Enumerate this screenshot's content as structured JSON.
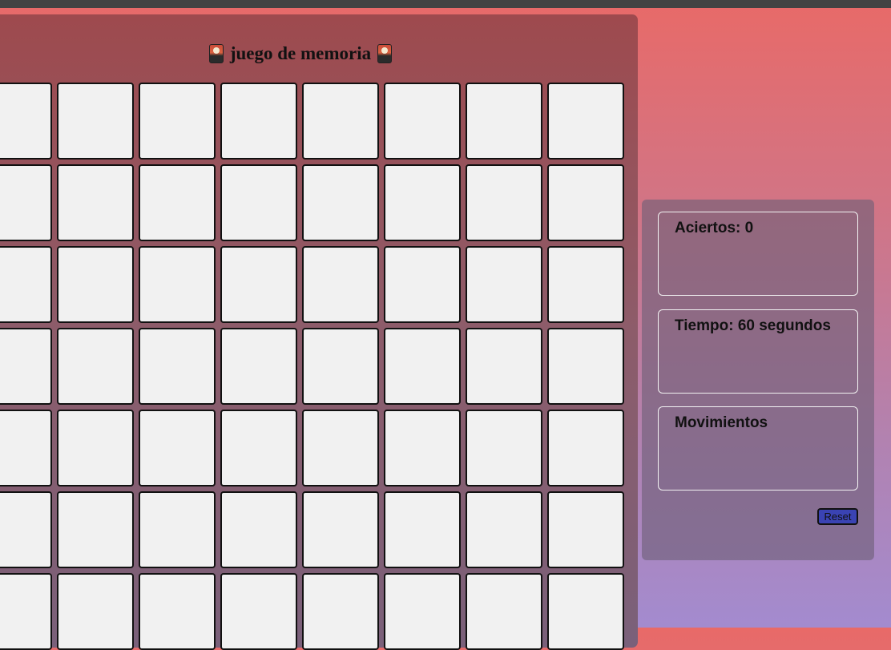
{
  "game": {
    "title": "juego de memoria",
    "title_icon": "playing-card-icon",
    "grid": {
      "rows": 7,
      "columns": 8
    }
  },
  "stats": {
    "aciertos": "Aciertos: 0",
    "tiempo": "Tiempo: 60 segundos",
    "movimientos": "Movimientos",
    "reset_label": "Reset"
  },
  "colors": {
    "card_face": "#f1f1f1",
    "reset_button": "#3a43b3"
  }
}
